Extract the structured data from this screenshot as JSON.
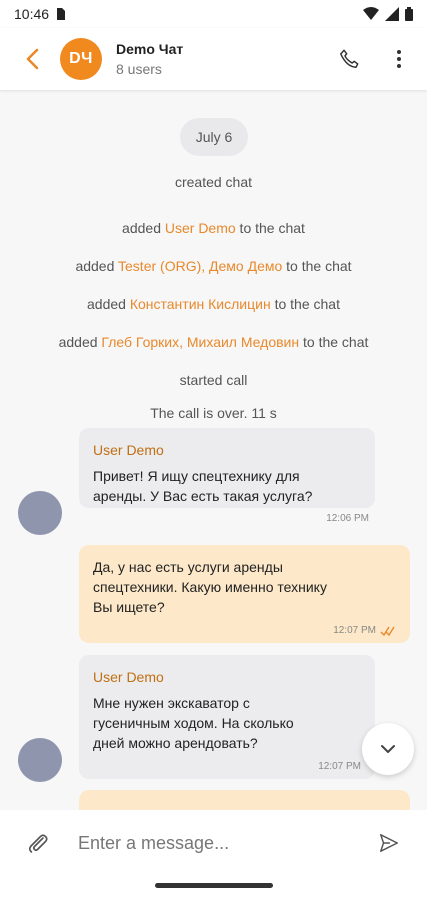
{
  "status": {
    "time": "10:46"
  },
  "header": {
    "avatar_initials": "DЧ",
    "title": "Demo Чат",
    "subtitle": "8 users"
  },
  "chat": {
    "date_label": "July 6",
    "system": [
      {
        "pre": "created chat",
        "hl": "",
        "post": ""
      },
      {
        "pre": "added ",
        "hl": "User Demo",
        "post": " to the chat"
      },
      {
        "pre": "added ",
        "hl": "Tester (ORG), Демо Демо",
        "post": " to the chat"
      },
      {
        "pre": "added ",
        "hl": "Константин Кислицин",
        "post": " to the chat"
      },
      {
        "pre": "added ",
        "hl": "Глеб Горких, Михаил Медовин",
        "post": " to the chat"
      },
      {
        "pre": "started call",
        "hl": "",
        "post": ""
      },
      {
        "pre": "The call is over. 11 s",
        "hl": "",
        "post": ""
      }
    ],
    "messages": [
      {
        "sender": "User Demo",
        "text": "Привет! Я ищу спецтехнику для\nаренды. У Вас есть такая услуга?",
        "time": "12:06 PM"
      },
      {
        "sender": "",
        "text": "Да, у нас есть услуги аренды\nспецтехники. Какую именно технику\nВы ищете?",
        "time": "12:07 PM"
      },
      {
        "sender": "User Demo",
        "text": "Мне нужен экскаватор с\nгусеничным ходом. На сколько\nдней можно арендовать?",
        "time": "12:07 PM"
      }
    ]
  },
  "input": {
    "placeholder": "Enter a message..."
  },
  "colors": {
    "accent": "#f08a1f",
    "outgoing": "#fde9c9",
    "incoming": "#ececef"
  }
}
